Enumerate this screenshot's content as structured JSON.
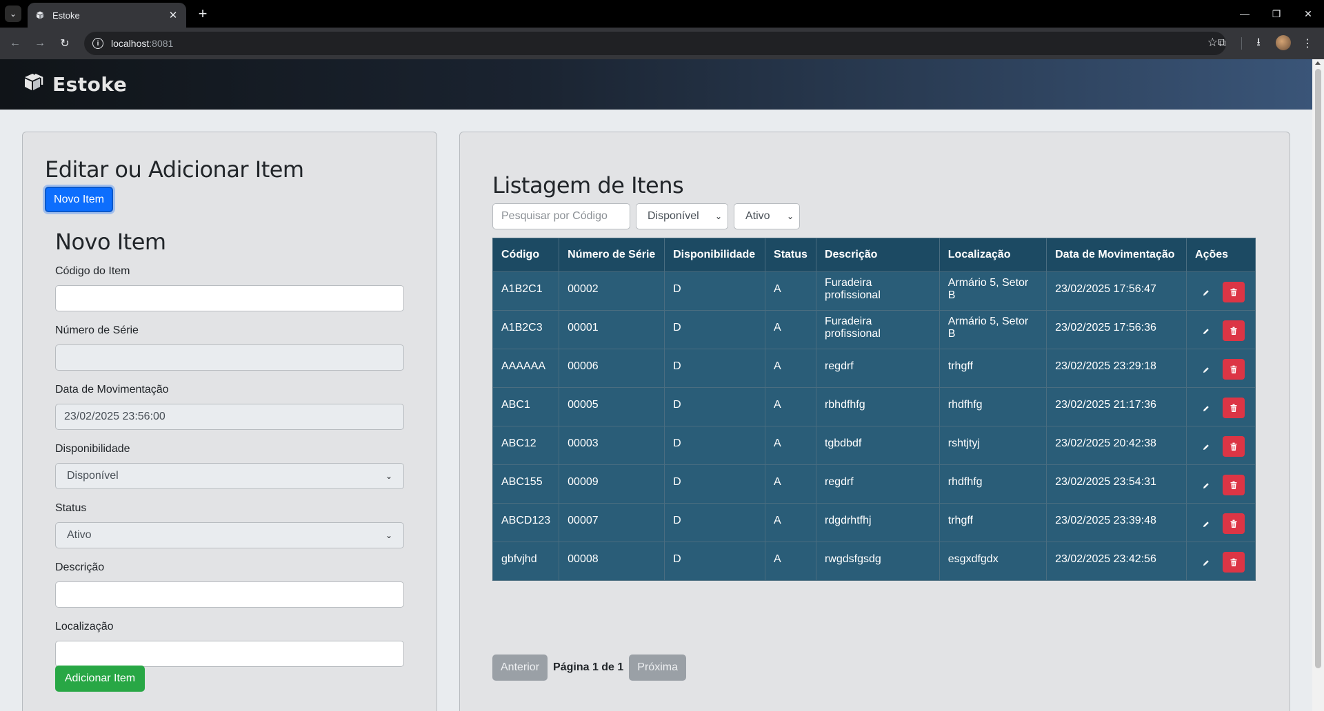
{
  "browser": {
    "tab_title": "Estoke",
    "url_host": "localhost",
    "url_port": ":8081"
  },
  "app": {
    "brand": "Estoke"
  },
  "form_panel": {
    "heading": "Editar ou Adicionar Item",
    "new_button": "Novo Item",
    "subheading": "Novo Item",
    "fields": {
      "codigo": {
        "label": "Código do Item",
        "value": ""
      },
      "numero_serie": {
        "label": "Número de Série",
        "value": ""
      },
      "data_movimentacao": {
        "label": "Data de Movimentação",
        "value": "23/02/2025 23:56:00"
      },
      "disponibilidade": {
        "label": "Disponibilidade",
        "value": "Disponível"
      },
      "status": {
        "label": "Status",
        "value": "Ativo"
      },
      "descricao": {
        "label": "Descrição",
        "value": ""
      },
      "localizacao": {
        "label": "Localização",
        "value": ""
      }
    },
    "submit_button": "Adicionar Item"
  },
  "list_panel": {
    "heading": "Listagem de Itens",
    "search_placeholder": "Pesquisar por Código",
    "filter_disponibilidade": "Disponível",
    "filter_status": "Ativo",
    "columns": [
      "Código",
      "Número de Série",
      "Disponibilidade",
      "Status",
      "Descrição",
      "Localização",
      "Data de Movimentação",
      "Ações"
    ],
    "rows": [
      [
        "A1B2C1",
        "00002",
        "D",
        "A",
        "Furadeira profissional",
        "Armário 5, Setor B",
        "23/02/2025 17:56:47"
      ],
      [
        "A1B2C3",
        "00001",
        "D",
        "A",
        "Furadeira profissional",
        "Armário 5, Setor B",
        "23/02/2025 17:56:36"
      ],
      [
        "AAAAAA",
        "00006",
        "D",
        "A",
        "regdrf",
        "trhgff",
        "23/02/2025 23:29:18"
      ],
      [
        "ABC1",
        "00005",
        "D",
        "A",
        "rbhdfhfg",
        "rhdfhfg",
        "23/02/2025 21:17:36"
      ],
      [
        "ABC12",
        "00003",
        "D",
        "A",
        "tgbdbdf",
        "rshtjtyj",
        "23/02/2025 20:42:38"
      ],
      [
        "ABC155",
        "00009",
        "D",
        "A",
        "regdrf",
        "rhdfhfg",
        "23/02/2025 23:54:31"
      ],
      [
        "ABCD123",
        "00007",
        "D",
        "A",
        "rdgdrhtfhj",
        "trhgff",
        "23/02/2025 23:39:48"
      ],
      [
        "gbfvjhd",
        "00008",
        "D",
        "A",
        "rwgdsfgsdg",
        "esgxdfgdx",
        "23/02/2025 23:42:56"
      ]
    ],
    "pagination": {
      "prev": "Anterior",
      "info": "Página 1 de 1",
      "next": "Próxima"
    }
  }
}
